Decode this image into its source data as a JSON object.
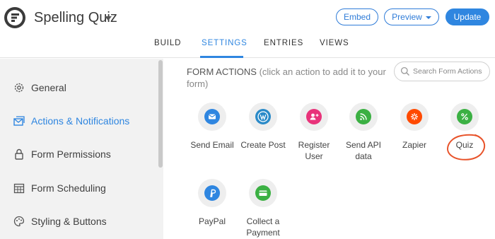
{
  "app": {
    "title": "Spelling Quiz",
    "logo_icon": "formidable-logo",
    "embed_label": "Embed",
    "preview_label": "Preview",
    "update_label": "Update",
    "accent": "#2f86e0"
  },
  "tabs": [
    {
      "label": "BUILD",
      "active": false
    },
    {
      "label": "SETTINGS",
      "active": true
    },
    {
      "label": "ENTRIES",
      "active": false
    },
    {
      "label": "VIEWS",
      "active": false
    }
  ],
  "sidebar": {
    "items": [
      {
        "label": "General",
        "icon": "gear-icon",
        "active": false
      },
      {
        "label": "Actions & Notifications",
        "icon": "envelope-icon",
        "active": true
      },
      {
        "label": "Form Permissions",
        "icon": "lock-icon",
        "active": false
      },
      {
        "label": "Form Scheduling",
        "icon": "calendar-icon",
        "active": false
      },
      {
        "label": "Styling & Buttons",
        "icon": "palette-icon",
        "active": false
      }
    ]
  },
  "main": {
    "heading": "FORM ACTIONS",
    "hint": "(click an action to add it to your form)",
    "search_placeholder": "Search Form Actions",
    "actions": [
      {
        "label": "Send Email",
        "icon": "email-icon",
        "color": "#2f86e0"
      },
      {
        "label": "Create Post",
        "icon": "wordpress-icon",
        "color": "#2a8ac8"
      },
      {
        "label": "Register User",
        "icon": "add-user-icon",
        "color": "#e8337a"
      },
      {
        "label": "Send API data",
        "icon": "api-feed-icon",
        "color": "#3bb043"
      },
      {
        "label": "Zapier",
        "icon": "zapier-icon",
        "color": "#ff4a00"
      },
      {
        "label": "Quiz",
        "icon": "percent-icon",
        "color": "#3bb043"
      },
      {
        "label": "PayPal",
        "icon": "paypal-icon",
        "color": "#2f86e0"
      },
      {
        "label": "Collect a Payment",
        "icon": "credit-card-icon",
        "color": "#3bb043"
      }
    ]
  }
}
